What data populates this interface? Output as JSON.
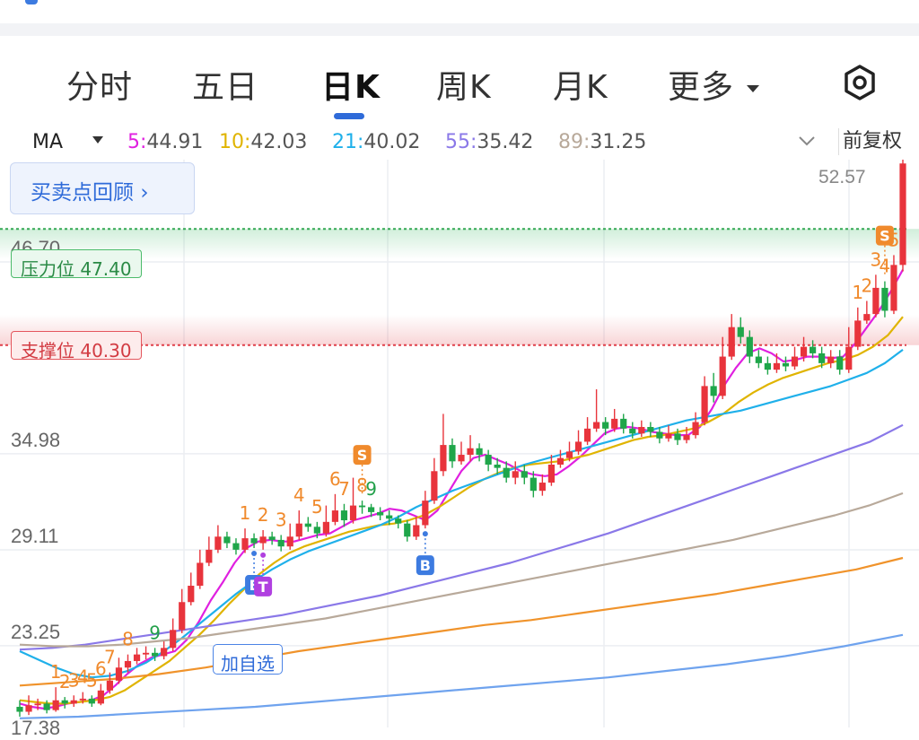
{
  "tabs": [
    {
      "label": "分时",
      "active": false
    },
    {
      "label": "五日",
      "active": false
    },
    {
      "label": "日K",
      "active": true
    },
    {
      "label": "周K",
      "active": false
    },
    {
      "label": "月K",
      "active": false
    },
    {
      "label": "更多",
      "active": false
    }
  ],
  "ma_bar": {
    "indicator": "MA",
    "ma5": {
      "label": "5:",
      "value": "44.91",
      "color": "#e020e0"
    },
    "ma10": {
      "label": "10:",
      "value": "42.03",
      "color": "#e0b400"
    },
    "ma21": {
      "label": "21:",
      "value": "40.02",
      "color": "#1fb0ea"
    },
    "ma55": {
      "label": "55:",
      "value": "35.42",
      "color": "#8a78e8"
    },
    "ma89": {
      "label": "89:",
      "value": "31.25",
      "color": "#b8a99a"
    },
    "adjust": "前复权"
  },
  "review_button": "买卖点回顾",
  "resistance": {
    "label": "压力位 47.40",
    "value": 47.4
  },
  "support": {
    "label": "支撑位 40.30",
    "value": 40.3
  },
  "add_watch": "加自选",
  "chart_data": {
    "type": "candlestick",
    "y_ticks": [
      {
        "label": "46.70",
        "value": 46.7
      },
      {
        "label": "34.98",
        "value": 34.98
      },
      {
        "label": "29.11",
        "value": 29.11
      },
      {
        "label": "23.25",
        "value": 23.25
      },
      {
        "label": "17.38",
        "value": 17.38
      }
    ],
    "ylim": [
      17.4,
      52.6
    ],
    "max_label": "52.57",
    "candles": [
      [
        18.2,
        17.9,
        18.6,
        17.6
      ],
      [
        17.9,
        18.3,
        18.9,
        17.7
      ],
      [
        18.3,
        18.4,
        18.7,
        18.0
      ],
      [
        18.4,
        18.0,
        18.6,
        17.8
      ],
      [
        18.0,
        18.6,
        19.4,
        17.9
      ],
      [
        18.6,
        18.4,
        18.8,
        18.1
      ],
      [
        18.4,
        18.6,
        18.9,
        18.2
      ],
      [
        18.6,
        18.7,
        19.1,
        18.4
      ],
      [
        18.7,
        18.4,
        18.9,
        18.2
      ],
      [
        18.4,
        19.2,
        19.6,
        18.3
      ],
      [
        19.2,
        19.8,
        20.3,
        19.0
      ],
      [
        19.8,
        20.6,
        21.2,
        19.6
      ],
      [
        20.6,
        21.0,
        21.4,
        20.3
      ],
      [
        21.0,
        21.4,
        21.8,
        20.8
      ],
      [
        21.4,
        21.5,
        21.9,
        21.1
      ],
      [
        21.5,
        21.3,
        21.8,
        21.0
      ],
      [
        21.3,
        21.8,
        22.2,
        21.1
      ],
      [
        21.8,
        22.9,
        23.6,
        21.6
      ],
      [
        22.9,
        24.6,
        25.4,
        22.7
      ],
      [
        24.6,
        25.6,
        26.4,
        24.4
      ],
      [
        25.6,
        27.0,
        27.8,
        25.4
      ],
      [
        27.0,
        27.8,
        28.6,
        26.8
      ],
      [
        27.8,
        28.6,
        29.3,
        27.6
      ],
      [
        28.6,
        28.2,
        28.9,
        27.9
      ],
      [
        28.2,
        27.8,
        28.5,
        27.5
      ],
      [
        27.8,
        28.5,
        29.1,
        27.6
      ],
      [
        28.5,
        28.2,
        28.8,
        27.9
      ],
      [
        28.2,
        28.6,
        29.0,
        27.8
      ],
      [
        28.6,
        28.4,
        28.9,
        28.1
      ],
      [
        28.4,
        28.0,
        28.7,
        27.7
      ],
      [
        28.0,
        28.6,
        29.4,
        27.8
      ],
      [
        28.6,
        29.4,
        30.2,
        28.4
      ],
      [
        29.4,
        29.2,
        29.8,
        28.9
      ],
      [
        29.2,
        28.8,
        29.5,
        28.5
      ],
      [
        28.8,
        29.5,
        30.5,
        28.6
      ],
      [
        29.5,
        30.2,
        31.2,
        29.3
      ],
      [
        30.2,
        29.6,
        30.6,
        29.2
      ],
      [
        29.6,
        30.5,
        32.2,
        29.4
      ],
      [
        30.5,
        30.4,
        30.8,
        30.0
      ],
      [
        30.4,
        30.1,
        30.6,
        29.8
      ],
      [
        30.1,
        29.9,
        30.4,
        29.6
      ],
      [
        29.9,
        29.7,
        30.2,
        29.3
      ],
      [
        29.7,
        29.4,
        29.9,
        29.1
      ],
      [
        29.4,
        28.6,
        29.6,
        28.3
      ],
      [
        28.6,
        29.3,
        29.8,
        28.4
      ],
      [
        29.3,
        30.8,
        31.4,
        29.1
      ],
      [
        30.8,
        32.6,
        33.4,
        30.6
      ],
      [
        32.6,
        34.2,
        36.1,
        32.3
      ],
      [
        34.2,
        33.2,
        34.6,
        32.8
      ],
      [
        33.2,
        33.6,
        34.4,
        33.0
      ],
      [
        33.6,
        34.0,
        34.8,
        33.2
      ],
      [
        34.0,
        33.6,
        34.3,
        33.2
      ],
      [
        33.6,
        33.0,
        33.9,
        32.6
      ],
      [
        33.0,
        32.8,
        33.4,
        32.4
      ],
      [
        32.8,
        32.2,
        33.2,
        31.9
      ],
      [
        32.2,
        32.6,
        33.2,
        31.8
      ],
      [
        32.6,
        32.2,
        33.0,
        31.8
      ],
      [
        32.2,
        31.4,
        32.6,
        31.0
      ],
      [
        31.4,
        31.9,
        32.4,
        31.1
      ],
      [
        31.9,
        33.0,
        33.6,
        31.7
      ],
      [
        33.0,
        33.4,
        33.9,
        32.8
      ],
      [
        33.4,
        33.8,
        34.4,
        33.2
      ],
      [
        33.8,
        34.4,
        35.1,
        33.6
      ],
      [
        34.4,
        35.2,
        35.9,
        34.2
      ],
      [
        35.2,
        35.6,
        37.6,
        35.0
      ],
      [
        35.6,
        35.2,
        35.9,
        34.8
      ],
      [
        35.2,
        35.8,
        36.4,
        35.0
      ],
      [
        35.8,
        35.2,
        36.1,
        34.9
      ],
      [
        35.2,
        34.9,
        35.6,
        34.6
      ],
      [
        34.9,
        35.3,
        35.7,
        34.7
      ],
      [
        35.3,
        35.0,
        35.6,
        34.7
      ],
      [
        35.0,
        34.6,
        35.3,
        34.3
      ],
      [
        34.6,
        34.9,
        35.4,
        34.4
      ],
      [
        34.9,
        34.5,
        35.2,
        34.2
      ],
      [
        34.5,
        34.8,
        35.3,
        34.3
      ],
      [
        34.8,
        35.6,
        36.2,
        34.6
      ],
      [
        35.6,
        37.8,
        38.4,
        35.4
      ],
      [
        37.8,
        37.2,
        38.6,
        36.8
      ],
      [
        37.2,
        39.6,
        40.8,
        37.0
      ],
      [
        39.6,
        41.4,
        42.2,
        39.4
      ],
      [
        41.4,
        40.8,
        42.0,
        40.4
      ],
      [
        40.8,
        39.6,
        41.2,
        39.2
      ],
      [
        39.6,
        39.2,
        40.0,
        38.9
      ],
      [
        39.2,
        38.8,
        39.6,
        38.5
      ],
      [
        38.8,
        39.2,
        39.8,
        38.6
      ],
      [
        39.2,
        39.0,
        39.6,
        38.7
      ],
      [
        39.0,
        39.6,
        40.2,
        38.8
      ],
      [
        39.6,
        40.2,
        40.8,
        39.3
      ],
      [
        40.2,
        39.8,
        40.6,
        39.5
      ],
      [
        39.8,
        39.2,
        40.2,
        38.9
      ],
      [
        39.2,
        39.6,
        40.0,
        38.9
      ],
      [
        39.6,
        38.8,
        40.0,
        38.5
      ],
      [
        38.8,
        40.2,
        41.4,
        38.6
      ],
      [
        40.2,
        41.8,
        42.6,
        40.0
      ],
      [
        41.8,
        42.2,
        43.0,
        41.6
      ],
      [
        42.2,
        43.8,
        44.6,
        42.0
      ],
      [
        43.8,
        42.4,
        44.2,
        42.0
      ],
      [
        42.4,
        45.2,
        45.8,
        42.2
      ],
      [
        45.2,
        51.4,
        52.57,
        44.8
      ]
    ],
    "series": [
      {
        "name": "5",
        "color": "#e020e0",
        "values": [
          18.4,
          18.2,
          18.1,
          18.2,
          18.4,
          18.5,
          18.6,
          18.9,
          19.5,
          20.2,
          20.8,
          21.2,
          21.4,
          21.6,
          22.3,
          23.4,
          24.7,
          25.8,
          27.0,
          27.9,
          28.3,
          28.4,
          28.3,
          28.3,
          28.5,
          28.7,
          28.8,
          29.2,
          29.6,
          29.8,
          30.0,
          30.3,
          30.2,
          29.9,
          29.6,
          30.2,
          31.4,
          32.6,
          33.4,
          33.6,
          33.3,
          33.0,
          32.6,
          32.4,
          32.3,
          32.4,
          32.9,
          33.5,
          34.2,
          34.9,
          35.2,
          35.3,
          35.2,
          35.0,
          34.9,
          34.8,
          34.8,
          35.3,
          36.4,
          37.8,
          38.9,
          39.8,
          40.1,
          39.8,
          39.3,
          39.4,
          39.6,
          39.6,
          39.5,
          39.6,
          40.4,
          41.4,
          42.4,
          43.6,
          44.91
        ]
      },
      {
        "name": "10",
        "color": "#e0b400",
        "values": [
          18.6,
          18.5,
          18.4,
          18.4,
          18.5,
          18.6,
          18.8,
          19.2,
          19.8,
          20.4,
          21.0,
          21.8,
          22.6,
          23.5,
          24.5,
          25.4,
          26.3,
          27.0,
          27.6,
          28.0,
          28.3,
          28.6,
          28.9,
          29.1,
          29.3,
          29.4,
          29.6,
          29.9,
          30.4,
          31.0,
          31.6,
          32.1,
          32.5,
          32.8,
          33.0,
          33.1,
          33.2,
          33.4,
          33.6,
          33.9,
          34.2,
          34.5,
          34.7,
          34.8,
          35.0,
          35.2,
          35.6,
          36.1,
          36.8,
          37.4,
          37.9,
          38.3,
          38.6,
          38.9,
          39.2,
          39.4,
          39.7,
          40.2,
          40.9,
          42.03
        ]
      },
      {
        "name": "21",
        "color": "#1fb0ea",
        "values": [
          21.6,
          21.1,
          20.6,
          20.2,
          20.0,
          20.1,
          20.4,
          20.9,
          21.6,
          22.4,
          23.3,
          24.2,
          25.1,
          25.9,
          26.6,
          27.2,
          27.7,
          28.1,
          28.5,
          28.9,
          29.3,
          29.8,
          30.4,
          30.9,
          31.4,
          31.8,
          32.2,
          32.6,
          33.0,
          33.3,
          33.6,
          33.9,
          34.2,
          34.5,
          34.8,
          35.1,
          35.4,
          35.7,
          35.9,
          36.1,
          36.3,
          36.6,
          36.9,
          37.2,
          37.5,
          37.8,
          38.2,
          38.6,
          39.2,
          40.02
        ]
      },
      {
        "name": "55",
        "color": "#8a78e8",
        "values": [
          21.7,
          21.8,
          22.0,
          22.3,
          22.6,
          22.9,
          23.2,
          23.5,
          23.8,
          24.2,
          24.6,
          25.0,
          25.5,
          26.0,
          26.5,
          27.0,
          27.6,
          28.2,
          28.8,
          29.5,
          30.2,
          30.9,
          31.6,
          32.3,
          33.0,
          33.7,
          34.4,
          35.42
        ]
      },
      {
        "name": "89",
        "color": "#b8a99a",
        "values": [
          22.0,
          21.9,
          21.9,
          22.0,
          22.2,
          22.4,
          22.7,
          23.0,
          23.3,
          23.6,
          24.0,
          24.4,
          24.8,
          25.2,
          25.6,
          26.0,
          26.4,
          26.8,
          27.2,
          27.6,
          28.0,
          28.4,
          28.9,
          29.4,
          29.9,
          30.5,
          31.25
        ]
      },
      {
        "name": "",
        "color": "#f0932b",
        "values": [
          19.5,
          19.7,
          19.9,
          20.2,
          20.6,
          21.1,
          21.6,
          22.0,
          22.4,
          22.8,
          23.2,
          23.5,
          23.9,
          24.3,
          24.7,
          25.1,
          25.6,
          26.1,
          26.6,
          27.3
        ]
      },
      {
        "name": "",
        "color": "#6fa3ee",
        "values": [
          17.5,
          17.6,
          17.8,
          18.0,
          18.2,
          18.5,
          18.8,
          19.1,
          19.4,
          19.7,
          20.0,
          20.4,
          20.8,
          21.3,
          21.9,
          22.6
        ]
      }
    ],
    "td_labels_green": [
      "9",
      "9"
    ],
    "td_labels_orange": [
      "1",
      "2",
      "3",
      "4",
      "5",
      "6",
      "7",
      "8",
      "1",
      "2",
      "3",
      "4",
      "5",
      "6",
      "7",
      "8",
      "1",
      "2",
      "3",
      "4",
      "5",
      "6"
    ],
    "signals": [
      {
        "label": "S",
        "type": "sell",
        "candle": 38
      },
      {
        "label": "B",
        "type": "buy",
        "candle": 45
      },
      {
        "label": "E",
        "type": "event",
        "candle": 26
      },
      {
        "label": "T",
        "type": "event2",
        "candle": 27
      },
      {
        "label": "S",
        "type": "sell",
        "candle": 96
      }
    ]
  }
}
